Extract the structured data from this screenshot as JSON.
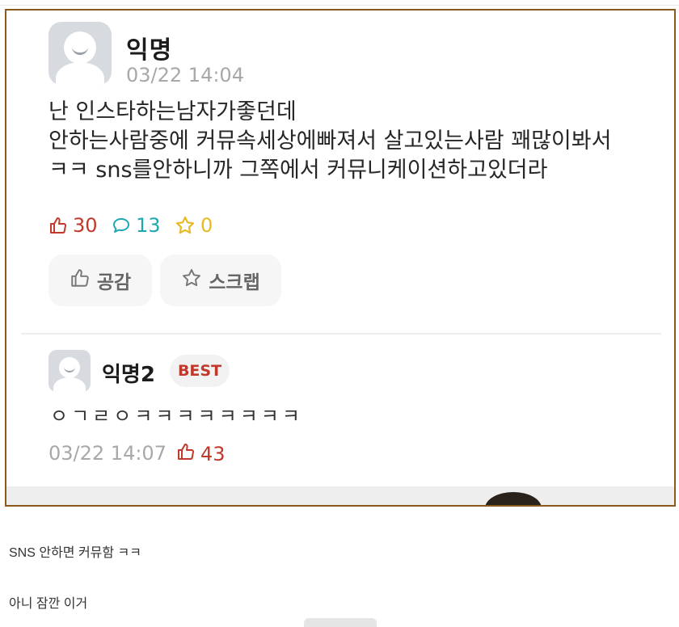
{
  "post": {
    "author": "익명",
    "timestamp": "03/22 14:04",
    "body_lines": [
      "난 인스타하는남자가좋던데",
      "안하는사람중에 커뮤속세상에빠져서 살고있는사람 꽤많이봐서",
      "ㅋㅋ sns를안하니까 그쪽에서 커뮤니케이션하고있더라"
    ],
    "stats": {
      "likes": "30",
      "comments": "13",
      "scraps": "0"
    },
    "actions": {
      "like_label": "공감",
      "scrap_label": "스크랩"
    }
  },
  "comment": {
    "author": "익명2",
    "badge": "BEST",
    "text": "ㅇㄱㄹㅇㅋㅋㅋㅋㅋㅋㅋㅋ",
    "timestamp": "03/22 14:07",
    "likes": "43"
  },
  "captions": [
    "SNS 안하면 커뮤함 ㅋㅋ",
    "아니 잠깐 이거"
  ],
  "colors": {
    "frame_border": "#8a5a1c",
    "like_red": "#c0392b",
    "comment_teal": "#1fa7b0",
    "scrap_yellow": "#e8b923"
  },
  "icons": {
    "like": "thumbs-up-icon",
    "comment": "speech-bubble-icon",
    "scrap": "star-icon",
    "avatar": "default-avatar-icon"
  }
}
